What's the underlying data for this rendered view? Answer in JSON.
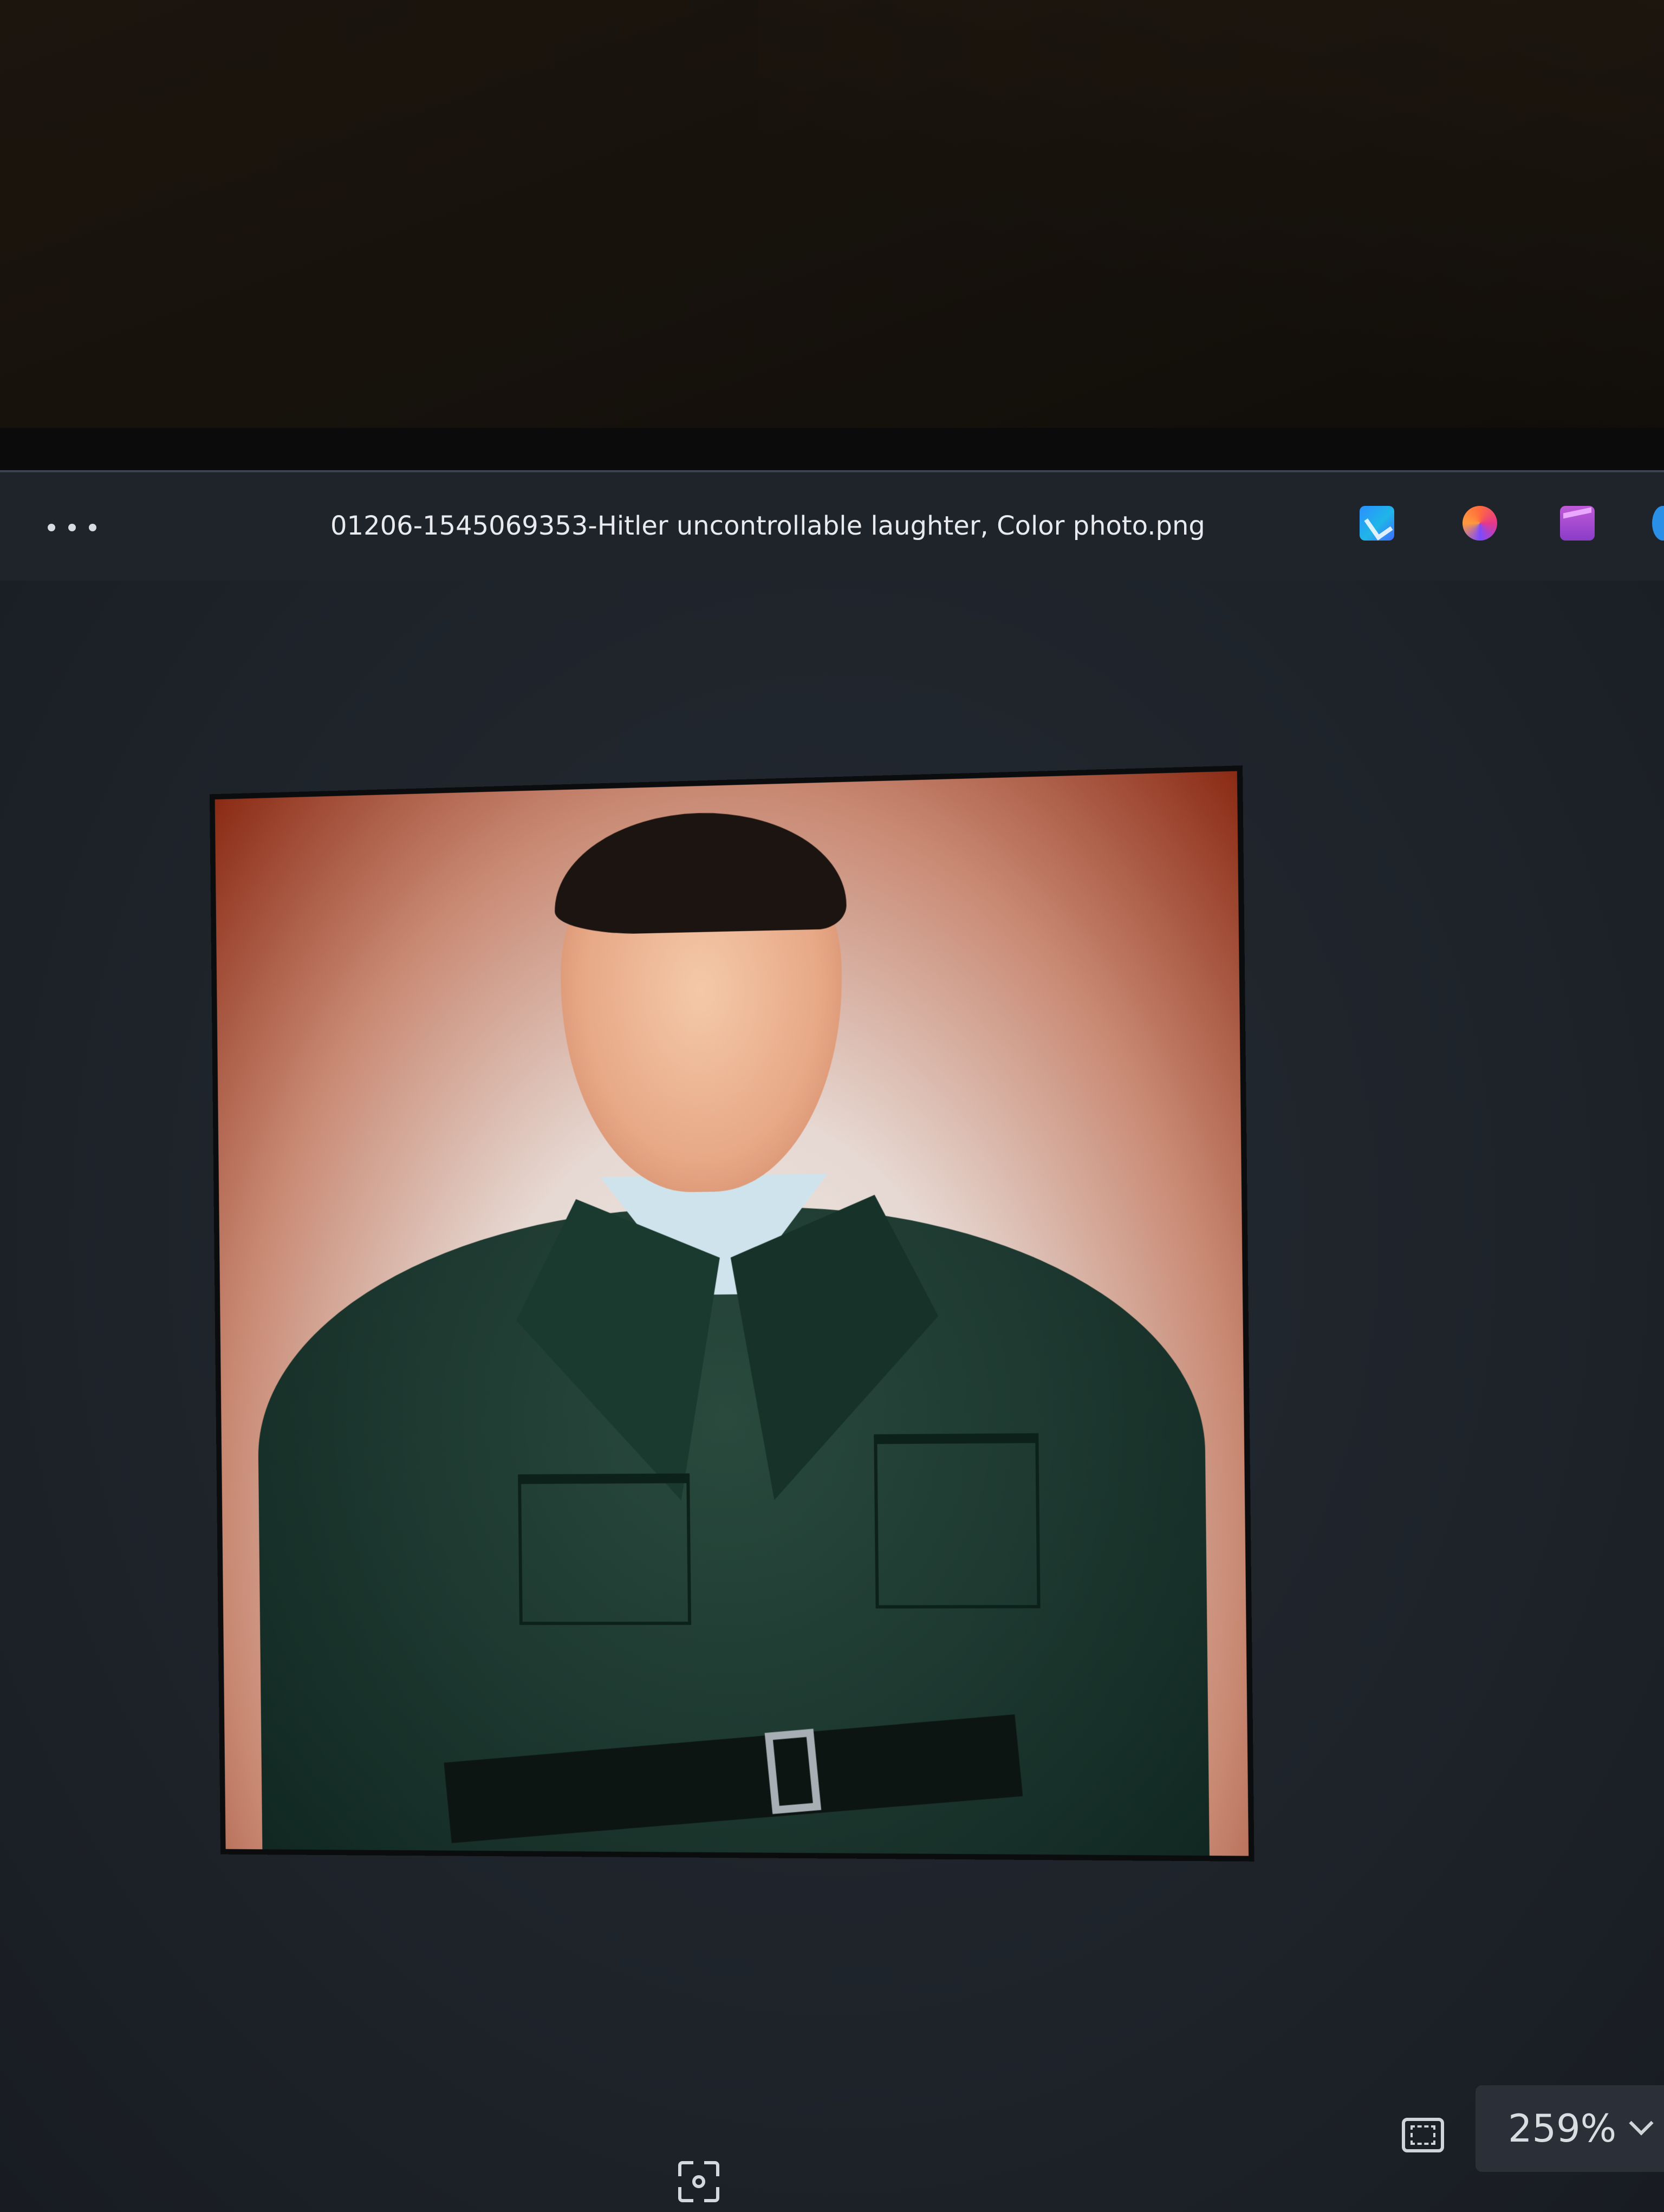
{
  "window": {
    "file_title": "01206-1545069353-Hitler uncontrollable laughter, Color photo.png"
  },
  "toolbar": {
    "more_icon": "more-horizontal-icon",
    "apps": [
      {
        "name": "designer-icon"
      },
      {
        "name": "copilot-icon"
      },
      {
        "name": "clipchamp-icon"
      }
    ]
  },
  "viewer": {
    "image_alt": "Color photo of a laughing man in a dark green uniform jacket against a red-to-white gradient background"
  },
  "bottombar": {
    "fit_icon": "fit-to-window-icon",
    "zoom_value": "259%",
    "zoom_icon": "chevron-down-icon",
    "scan_icon": "visual-search-icon"
  },
  "colors": {
    "window_bg": "#1f242b",
    "title_text": "#e8eaed",
    "photo_bg_top": "#8a2a14",
    "uniform": "#1e3a31"
  }
}
